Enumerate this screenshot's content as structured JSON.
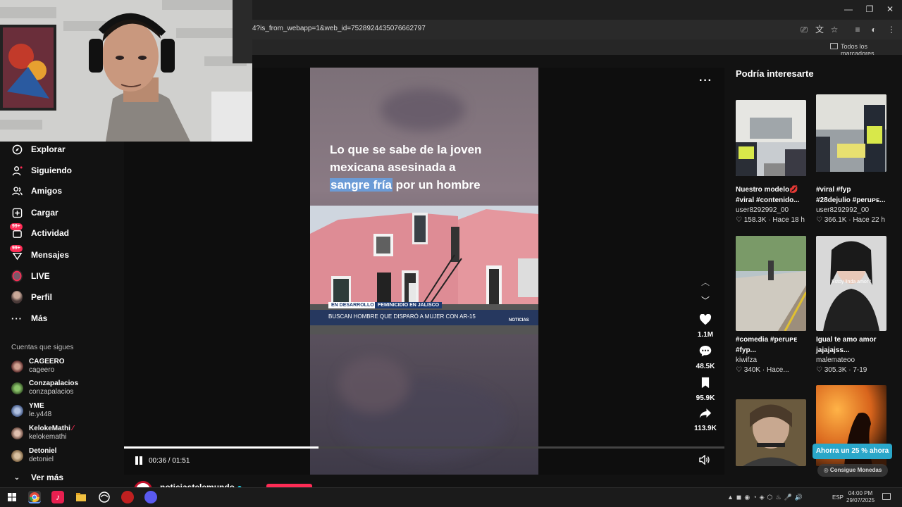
{
  "browser": {
    "url": "4?is_from_webapp=1&web_id=7528924435076662797",
    "bookmarks_label": "Todos los marcadores",
    "window_controls": [
      "minimize-icon",
      "restore-icon",
      "close-icon"
    ]
  },
  "sidebar": {
    "items": [
      {
        "label": "Explorar",
        "icon": "compass-icon"
      },
      {
        "label": "Siguiendo",
        "icon": "person-icon"
      },
      {
        "label": "Amigos",
        "icon": "friends-icon"
      },
      {
        "label": "Cargar",
        "icon": "upload-icon"
      },
      {
        "label": "Actividad",
        "icon": "activity-icon",
        "badge": "99+"
      },
      {
        "label": "Mensajes",
        "icon": "message-icon",
        "badge": "99+"
      },
      {
        "label": "LIVE",
        "icon": "live-icon"
      },
      {
        "label": "Perfil",
        "icon": "profile-icon"
      },
      {
        "label": "Más",
        "icon": "ellipsis-icon"
      }
    ],
    "following_title": "Cuentas que sigues",
    "following": [
      {
        "name": "CAGEERO",
        "handle": "cageero"
      },
      {
        "name": "Conzapalacios",
        "handle": "conzapalacios"
      },
      {
        "name": "YME",
        "handle": "le.y448"
      },
      {
        "name": "KelokeMathi",
        "handle": "kelokemathi"
      },
      {
        "name": "Detoniel",
        "handle": "detoniel"
      }
    ],
    "see_more": "Ver más"
  },
  "video": {
    "caption_line1": "Lo que se sabe de la joven",
    "caption_line2": "mexicana asesinada a",
    "caption_highlight": "sangre fría",
    "caption_line3_rest": " por un hombre",
    "tag1": "EN DESARROLLO",
    "tag2": "FEMINICIDIO EN JALISCO",
    "lower_third": "BUSCAN HOMBRE QUE DISPARÓ A MUJER CON AR-15",
    "network": "NOTICIAS",
    "time": "00:36 / 01:51",
    "progress": 0.324,
    "likes": "1.1M",
    "comments": "48.5K",
    "saves": "95.9K",
    "shares": "113.9K",
    "author": "noticiastelemundo"
  },
  "recommendations": {
    "title": "Podría interesarte",
    "items": [
      {
        "caption1": "Nuestro modelo💋",
        "caption2": "#viral #contenido...",
        "user": "user8292992_00",
        "meta": "♡ 158.3K · Hace 18 h"
      },
      {
        "caption1": "#viral #fyp",
        "caption2": "#28dejulio #peruᴘᴇ...",
        "user": "user8292992_00",
        "meta": "♡ 366.1K · Hace 22 h"
      },
      {
        "caption1": "#comedia #peruᴘᴇ",
        "caption2": "#fyp...",
        "user": "kiwifza",
        "meta": "♡ 340K · Hace..."
      },
      {
        "caption1": "Igual te amo amor",
        "caption2": "jajajajss...",
        "user": "malemateoo",
        "meta": "♡ 305.3K · 7-19"
      }
    ],
    "thumb4_text": "Estoy linda amor?",
    "promo": "Ahorra un 25 % ahora",
    "coins": "Consigue Monedas"
  },
  "taskbar": {
    "lang": "ESP",
    "time": "04:00 PM",
    "date": "29/07/2025"
  },
  "colors": {
    "accent": "#fe2c55",
    "promo": "#2aa7c9",
    "news_blue": "#1c3970"
  }
}
